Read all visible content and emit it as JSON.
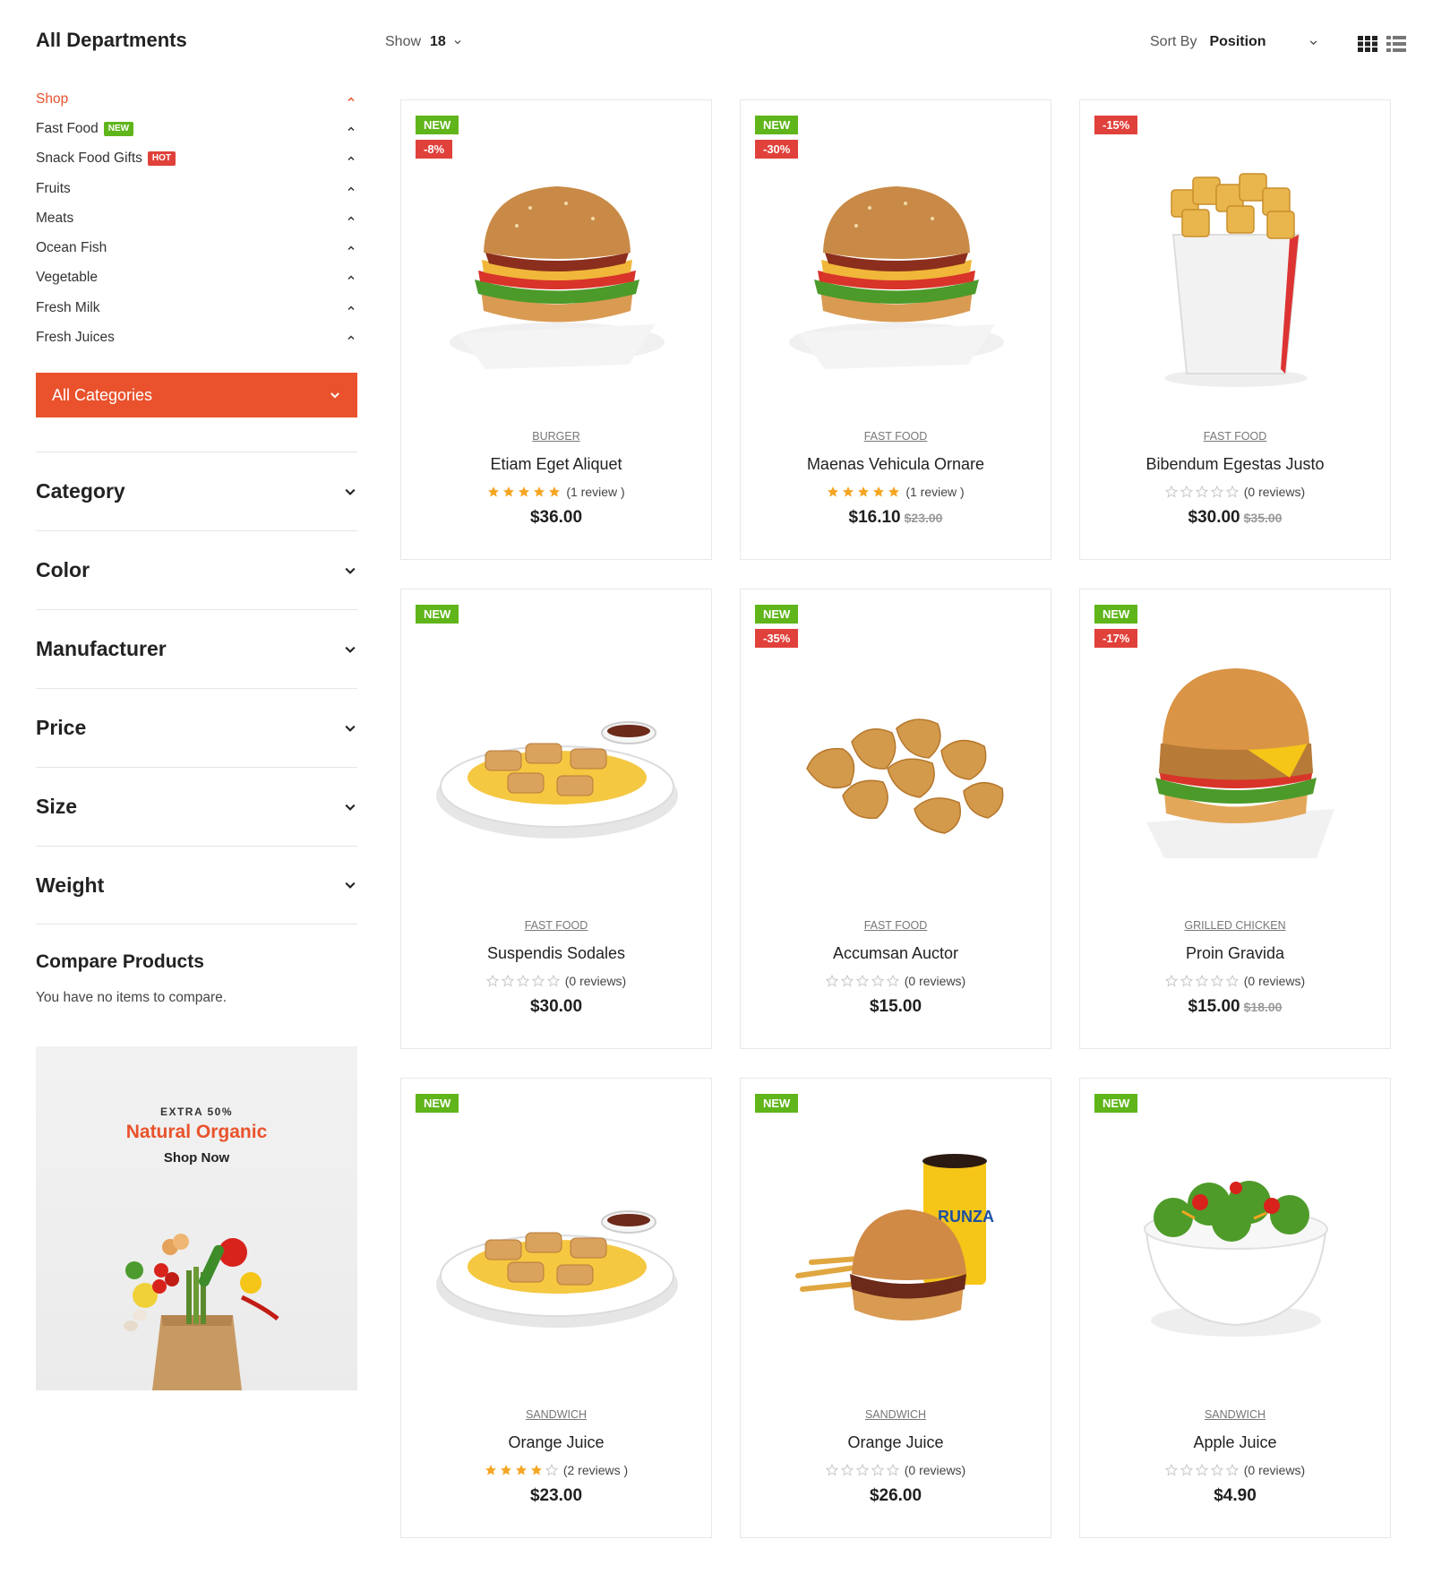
{
  "sidebar": {
    "title": "All Departments",
    "departments": [
      {
        "label": "Shop",
        "badge": "",
        "active": true
      },
      {
        "label": "Fast Food",
        "badge": "NEW",
        "active": false
      },
      {
        "label": "Snack Food Gifts",
        "badge": "HOT",
        "active": false
      },
      {
        "label": "Fruits",
        "badge": "",
        "active": false
      },
      {
        "label": "Meats",
        "badge": "",
        "active": false
      },
      {
        "label": "Ocean Fish",
        "badge": "",
        "active": false
      },
      {
        "label": "Vegetable",
        "badge": "",
        "active": false
      },
      {
        "label": "Fresh Milk",
        "badge": "",
        "active": false
      },
      {
        "label": "Fresh Juices",
        "badge": "",
        "active": false
      }
    ],
    "all_categories_label": "All Categories",
    "filters": [
      "Category",
      "Color",
      "Manufacturer",
      "Price",
      "Size",
      "Weight"
    ],
    "compare": {
      "title": "Compare Products",
      "text": "You have no items to compare."
    },
    "promo": {
      "kicker": "EXTRA 50%",
      "title": "Natural Organic",
      "cta": "Shop Now"
    }
  },
  "toolbar": {
    "show_label": "Show",
    "show_value": "18",
    "sort_label": "Sort By",
    "sort_value": "Position",
    "icons": [
      "grid-view-icon",
      "list-view-icon"
    ]
  },
  "colors": {
    "accent": "#e9522c",
    "badge_new": "#5fb51a",
    "badge_sale": "#e0413b",
    "star": "#f5a623"
  },
  "products": [
    {
      "category": "BURGER",
      "name": "Etiam Eget Aliquet",
      "stars": 5,
      "review_text": "(1 review )",
      "price": "$36.00",
      "old_price": "",
      "badges": [
        "NEW",
        "-8%"
      ],
      "image": "burger"
    },
    {
      "category": "FAST FOOD",
      "name": "Maenas Vehicula Ornare",
      "stars": 5,
      "review_text": "(1 review )",
      "price": "$16.10",
      "old_price": "$23.00",
      "badges": [
        "NEW",
        "-30%"
      ],
      "image": "burger"
    },
    {
      "category": "FAST FOOD",
      "name": "Bibendum Egestas Justo",
      "stars": 0,
      "review_text": "(0 reviews)",
      "price": "$30.00",
      "old_price": "$35.00",
      "badges": [
        "-15%"
      ],
      "image": "fries"
    },
    {
      "category": "FAST FOOD",
      "name": "Suspendis Sodales",
      "stars": 0,
      "review_text": "(0 reviews)",
      "price": "$30.00",
      "old_price": "",
      "badges": [
        "NEW"
      ],
      "image": "plate"
    },
    {
      "category": "FAST FOOD",
      "name": "Accumsan Auctor",
      "stars": 0,
      "review_text": "(0 reviews)",
      "price": "$15.00",
      "old_price": "",
      "badges": [
        "NEW",
        "-35%"
      ],
      "image": "nuggets"
    },
    {
      "category": "GRILLED CHICKEN",
      "name": "Proin Gravida",
      "stars": 0,
      "review_text": "(0 reviews)",
      "price": "$15.00",
      "old_price": "$18.00",
      "badges": [
        "NEW",
        "-17%"
      ],
      "image": "chicken-burger"
    },
    {
      "category": "SANDWICH",
      "name": "Orange Juice",
      "stars": 4,
      "review_text": "(2 reviews )",
      "price": "$23.00",
      "old_price": "",
      "badges": [
        "NEW"
      ],
      "image": "plate"
    },
    {
      "category": "SANDWICH",
      "name": "Orange Juice",
      "stars": 0,
      "review_text": "(0 reviews)",
      "price": "$26.00",
      "old_price": "",
      "badges": [
        "NEW"
      ],
      "image": "combo"
    },
    {
      "category": "SANDWICH",
      "name": "Apple Juice",
      "stars": 0,
      "review_text": "(0 reviews)",
      "price": "$4.90",
      "old_price": "",
      "badges": [
        "NEW"
      ],
      "image": "salad"
    }
  ]
}
